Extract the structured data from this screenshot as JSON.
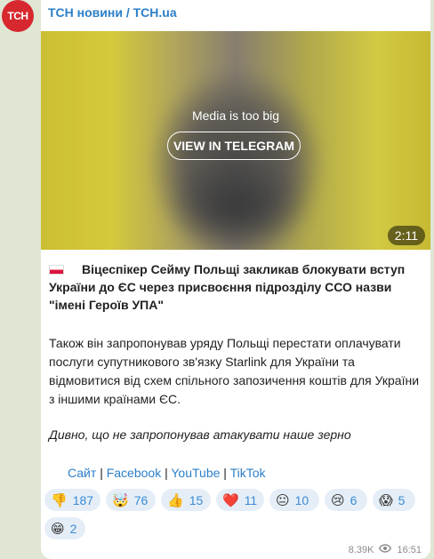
{
  "channel": {
    "avatar_text": "ТСН",
    "name": "ТСН новини / TCH.ua"
  },
  "media": {
    "notice": "Media is too big",
    "button": "VIEW IN TELEGRAM",
    "duration": "2:11"
  },
  "post": {
    "headline": "Віцеспікер Сейму Польщі закликав блокувати вступ України до ЄС через присвоєння підрозділу ССО назви \"імені Героїв УПА\"",
    "paragraph": "Також він запропонував уряду Польщі перестати оплачувати послуги супутникового зв'язку Starlink для України та відмовитися від схем спільного запозичення коштів для України з іншими країнами ЄС.",
    "italic": "Дивно, що не запропонував атакувати наше зерно"
  },
  "links": [
    {
      "label": "Сайт"
    },
    {
      "label": "Facebook"
    },
    {
      "label": "YouTube"
    },
    {
      "label": "TikTok"
    }
  ],
  "reactions": [
    {
      "emoji": "👎",
      "count": "187"
    },
    {
      "emoji": "🤯",
      "count": "76"
    },
    {
      "emoji": "👍",
      "count": "15"
    },
    {
      "emoji": "❤️",
      "count": "11"
    },
    {
      "emoji": "😐",
      "count": "10"
    },
    {
      "emoji": "😢",
      "count": "6"
    },
    {
      "emoji": "😱",
      "count": "5"
    },
    {
      "emoji": "😁",
      "count": "2"
    }
  ],
  "footer": {
    "views": "8.39K",
    "time": "16:51"
  }
}
